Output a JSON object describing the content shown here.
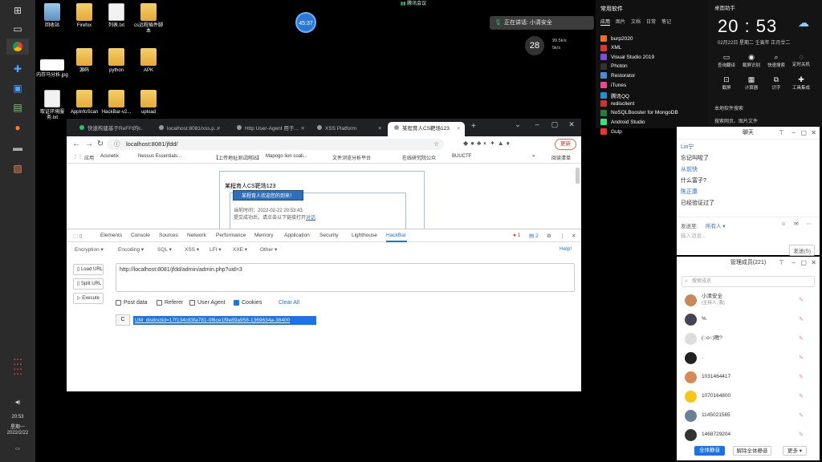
{
  "desktop_icons": [
    {
      "label": "回收站",
      "kind": "bin"
    },
    {
      "label": "Firefox",
      "kind": "folder"
    },
    {
      "label": "列表.txt",
      "kind": "doc"
    },
    {
      "label": "cs远程插件脚本",
      "kind": "folder"
    },
    {
      "label": "内存马分析.jpg",
      "kind": "banner"
    },
    {
      "label": "源码",
      "kind": "folder"
    },
    {
      "label": "python",
      "kind": "folder"
    },
    {
      "label": "APK",
      "kind": "folder"
    },
    {
      "label": "取证环境服务.txt",
      "kind": "doc"
    },
    {
      "label": "AppInfoScan",
      "kind": "folder"
    },
    {
      "label": "HackBar-v2...",
      "kind": "folder"
    },
    {
      "label": "upload",
      "kind": "folder"
    }
  ],
  "meeting": {
    "title": "腾讯会议",
    "timer": "45:37",
    "speaking": "正在讲话: 小清安全"
  },
  "weather": {
    "temp": "28",
    "net_up": "99.5k/s",
    "net_down": "5k/s"
  },
  "startmenu": {
    "title": "常用软件",
    "tabs": [
      "应用",
      "图片",
      "文档",
      "日常",
      "笔记"
    ],
    "apps": [
      "burp2020",
      "XML",
      "Visual Studio 2019",
      "Photon",
      "Restorator",
      "iTunes",
      "腾讯QQ",
      "redisclient",
      "NoSQLBooster for MongoDB",
      "Android Studio",
      "Gulp"
    ]
  },
  "clock": {
    "title": "桌面助手",
    "time": "20 : 53",
    "date": "02月22日  星期二     壬寅年 正月廿二",
    "actions_row1": [
      "查询翻译",
      "截屏识别",
      "快速搜索",
      "定时关机"
    ],
    "actions_row2": [
      "截屏",
      "计算器",
      "识字",
      "工具集成"
    ],
    "line1": "本地软件搜索",
    "line2": "搜索网页、图片文件"
  },
  "browser": {
    "tabs": [
      {
        "label": "快速构建基于ReFFt的..."
      },
      {
        "label": "localhost:8081/xss.p..."
      },
      {
        "label": "Http User-Agent 用于..."
      },
      {
        "label": "XSS Platform"
      },
      {
        "label": "某程育人CS靶场123"
      }
    ],
    "url": "localhost:8081/jfdd/",
    "update_label": "更新",
    "bookmarks": [
      "应用",
      "Acunetix",
      "Nessus Essentials...",
      "【上传地址测试网站】",
      "Mapogo lion coali...",
      "文件浏览分析平台",
      "在线研究院公众",
      "BUUCTF"
    ],
    "bookmarks_extra": "阅读清单",
    "page": {
      "title": "某程育人CS靶场123",
      "welcome": "某程育人欢迎您的到来！",
      "line1": "当前时间：2022-02-22 20:53:43",
      "line2_prefix": "提交成功后，请点击以下链接打开",
      "line2_link": "对话"
    }
  },
  "devtools": {
    "tabs": [
      "Elements",
      "Console",
      "Sources",
      "Network",
      "Performance",
      "Memory",
      "Application",
      "Security",
      "Lighthouse",
      "HackBar"
    ],
    "errors": "1",
    "warnings": "2",
    "hackbar": {
      "menus": [
        "Encryption ▾",
        "Encoding ▾",
        "SQL ▾",
        "XSS ▾",
        "LFI ▾",
        "XXE ▾",
        "Other ▾"
      ],
      "help": "Help!",
      "buttons": [
        "Load URL",
        "Split URL",
        "Execute"
      ],
      "url_value": "http://localhost:8081/jfdd/admin/admin.php?uid=3",
      "options": [
        {
          "label": "Post data",
          "checked": false
        },
        {
          "label": "Referer",
          "checked": false
        },
        {
          "label": "User Agent",
          "checked": false
        },
        {
          "label": "Cookies",
          "checked": true
        }
      ],
      "clear_all": "Clear All",
      "cookie_prefix": "C",
      "cookie_value": "UM_distinctid=17f134c83fa781-0f6ce1f9e89a958-1369634a-38400"
    }
  },
  "chat": {
    "title": "聊天",
    "messages": [
      {
        "text": "Lin宁",
        "name": true
      },
      {
        "text": "忘记叫啦了",
        "name": false
      },
      {
        "text": "从前快",
        "name": true
      },
      {
        "text": "什么富子?",
        "name": false
      },
      {
        "text": "陈正康",
        "name": true
      },
      {
        "text": "已经验证过了",
        "name": false
      }
    ],
    "send_to_label": "发送至:",
    "send_to_value": "所有人 ▾",
    "input_placeholder": "输入消息...",
    "send_button": "发送(S)"
  },
  "members": {
    "title": "管理成员(221)",
    "search_placeholder": "搜索成员",
    "list": [
      {
        "name": "小清安全",
        "sub": "(主持人, 我)",
        "color": "#c88a5a"
      },
      {
        "name": "%",
        "sub": "",
        "color": "#445"
      },
      {
        "name": "(○o○)嗯?",
        "sub": "",
        "color": "#ddd"
      },
      {
        "name": ".",
        "sub": "",
        "color": "#222"
      },
      {
        "name": "1031464417",
        "sub": "",
        "color": "#d9885a"
      },
      {
        "name": "1070164800",
        "sub": "",
        "color": "#f5c518"
      },
      {
        "name": "1145021565",
        "sub": "",
        "color": "#6a7f9a"
      },
      {
        "name": "1468729204",
        "sub": "",
        "color": "#333"
      }
    ],
    "mute_all": "全体静音",
    "unmute_all": "解除全体静音",
    "more": "更多 ▾"
  },
  "tray": {
    "time": "20:53",
    "weekday": "星期一",
    "date": "2022/2/22"
  }
}
